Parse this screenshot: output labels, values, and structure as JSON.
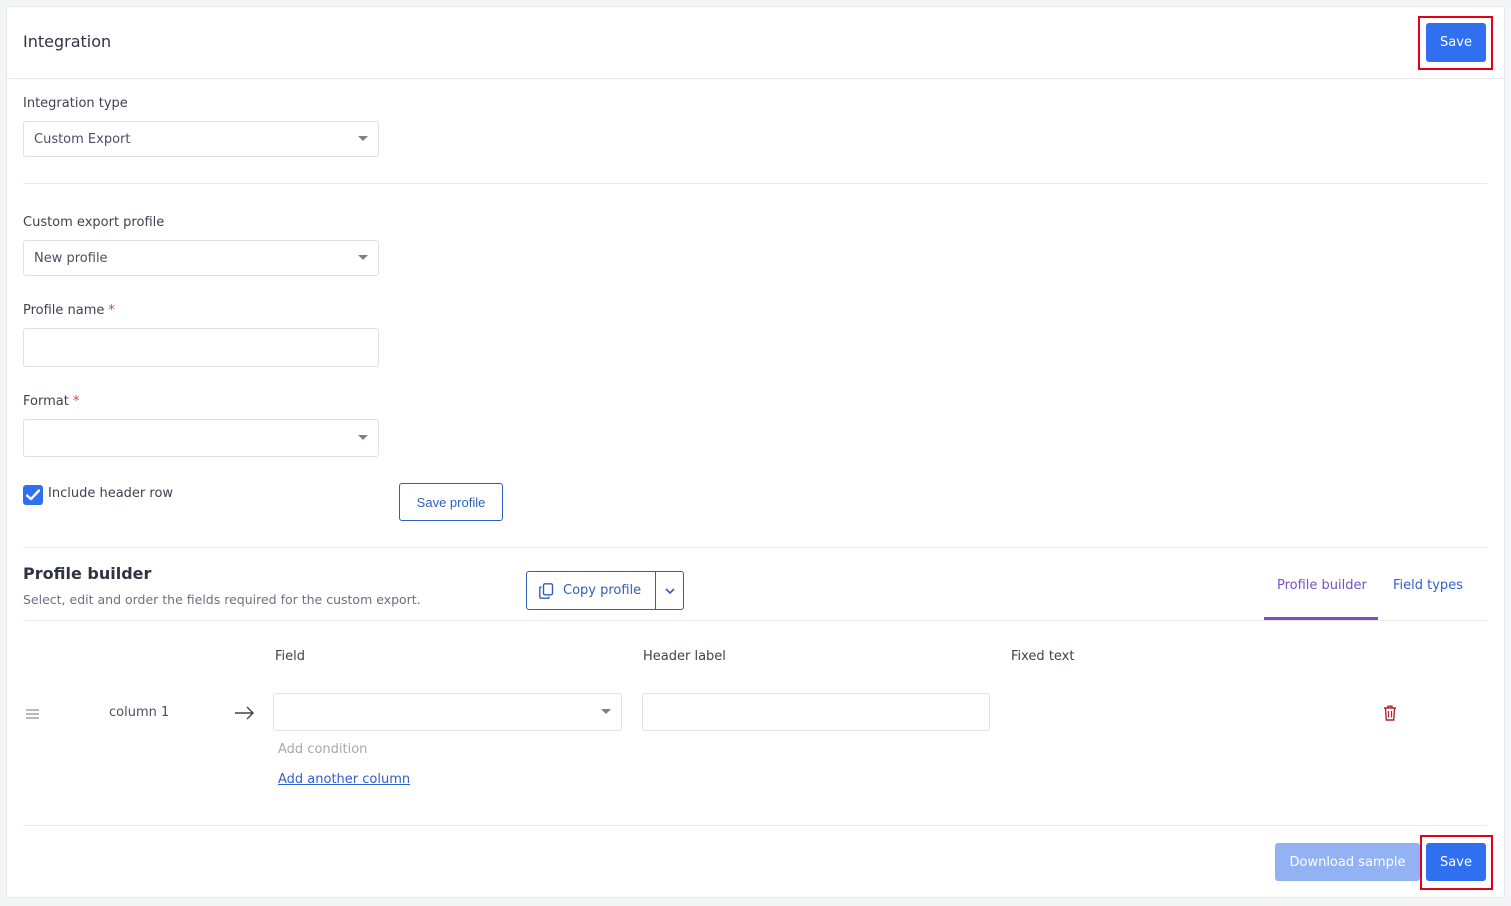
{
  "header": {
    "title": "Integration",
    "save_label": "Save"
  },
  "integration": {
    "type_label": "Integration type",
    "type_value": "Custom Export"
  },
  "profile": {
    "export_profile_label": "Custom export profile",
    "export_profile_value": "New profile",
    "name_label": "Profile name",
    "name_value": "",
    "format_label": "Format",
    "format_value": "",
    "required_mark": "*",
    "include_header_label": "Include header row",
    "include_header_checked": true,
    "save_profile_label": "Save profile"
  },
  "builder": {
    "title": "Profile builder",
    "description": "Select, edit and order the fields required for the custom export.",
    "copy_profile_label": "Copy profile",
    "tabs": [
      {
        "label": "Profile builder",
        "active": true
      },
      {
        "label": "Field types",
        "active": false
      }
    ],
    "columns": {
      "field": "Field",
      "header_label": "Header label",
      "fixed_text": "Fixed text"
    },
    "rows": [
      {
        "name": "column 1",
        "field_value": "",
        "header_value": ""
      }
    ],
    "add_condition": "Add condition",
    "add_column": "Add another column"
  },
  "footer": {
    "download_sample_label": "Download sample",
    "save_label": "Save"
  },
  "colors": {
    "primary": "#2f6ff0",
    "highlight": "#e5001a",
    "tab_active": "#7b4fc8",
    "delete_icon": "#b0252b"
  }
}
